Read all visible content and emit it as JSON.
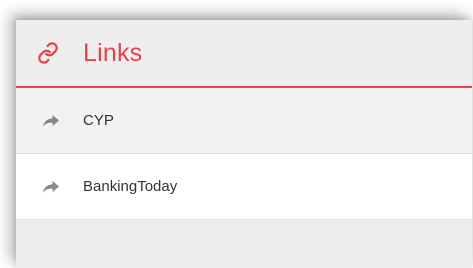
{
  "widget": {
    "title": "Links",
    "header_icon": "link-icon",
    "accent_color": "#e8414b",
    "items": [
      {
        "label": "CYP",
        "icon": "share-arrow-icon"
      },
      {
        "label": "BankingToday",
        "icon": "share-arrow-icon"
      }
    ]
  }
}
